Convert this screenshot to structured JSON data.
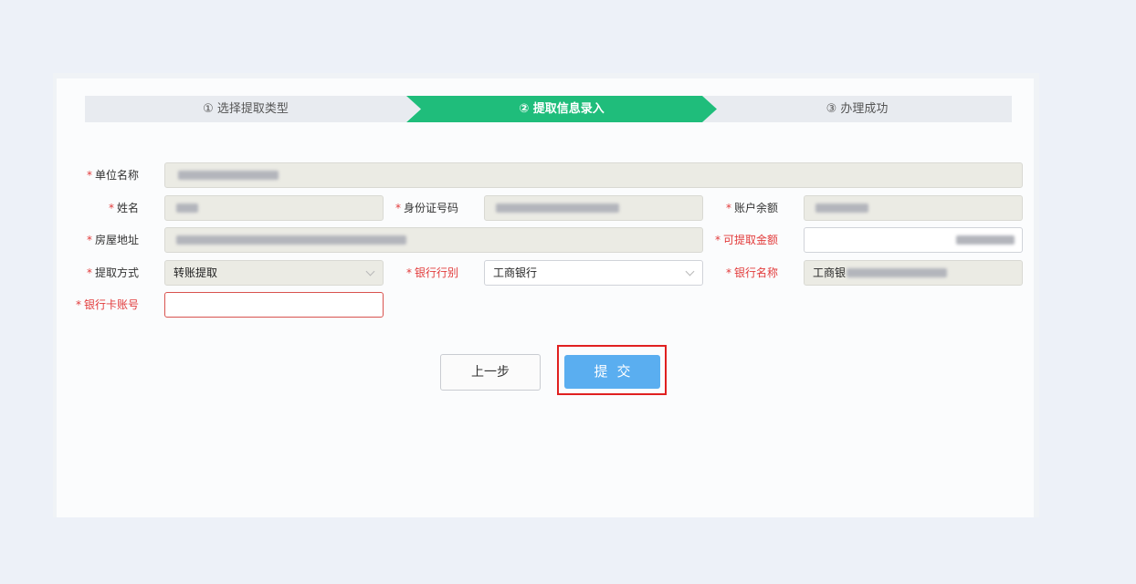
{
  "steps": {
    "step1": "① 选择提取类型",
    "step2": "② 提取信息录入",
    "step3": "③ 办理成功"
  },
  "form": {
    "unit_name_label": "单位名称",
    "name_label": "姓名",
    "id_number_label": "身份证号码",
    "account_balance_label": "账户余额",
    "address_label": "房屋地址",
    "withdrawable_amount_label": "可提取金额",
    "withdraw_method_label": "提取方式",
    "withdraw_method_value": "转账提取",
    "bank_type_label": "银行行别",
    "bank_type_value": "工商银行",
    "bank_name_label": "银行名称",
    "bank_name_value_prefix": "工商银",
    "card_number_label": "银行卡账号",
    "required_star": "*"
  },
  "buttons": {
    "prev": "上一步",
    "submit": "提交"
  }
}
